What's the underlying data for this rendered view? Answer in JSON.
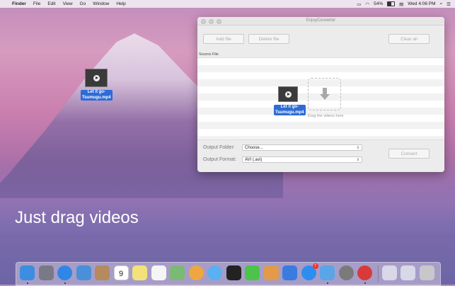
{
  "menubar": {
    "app_name": "Finder",
    "items": [
      "File",
      "Edit",
      "View",
      "Go",
      "Window",
      "Help"
    ],
    "battery_percent": "54%",
    "clock": "Wed 4:06 PM"
  },
  "desktop_file": {
    "name_line1": "Let it go-",
    "name_line2": "Tsumugu.mp4"
  },
  "window": {
    "title": "EnjoyConverter",
    "buttons": {
      "add": "Add file",
      "delete": "Delete file",
      "clear": "Clear all",
      "convert": "Convert"
    },
    "source_label": "Source File",
    "dragged_file": {
      "name_line1": "Let it go-",
      "name_line2": "Tsumugu.mp4"
    },
    "drop_hint": "Drag the videos here",
    "output_folder_label": "Output  Folder:",
    "output_folder_value": "Choose...",
    "output_format_label": "Output Format:",
    "output_format_value": "AVI (.avi)"
  },
  "headline": "Just drag videos",
  "dock": {
    "calendar_day": "9",
    "app_store_badge": "7",
    "icons": [
      {
        "name": "finder-icon",
        "color": "#3d8de0"
      },
      {
        "name": "launchpad-icon",
        "color": "#7a7a86"
      },
      {
        "name": "safari-icon",
        "color": "#2f86e6"
      },
      {
        "name": "mail-icon",
        "color": "#4a90d9"
      },
      {
        "name": "contacts-icon",
        "color": "#b48a5e"
      },
      {
        "name": "calendar-icon",
        "color": "#ffffff"
      },
      {
        "name": "notes-icon",
        "color": "#f3e27a"
      },
      {
        "name": "reminders-icon",
        "color": "#f5f5f5"
      },
      {
        "name": "maps-icon",
        "color": "#7cb974"
      },
      {
        "name": "photos-icon",
        "color": "#f0a640"
      },
      {
        "name": "messages-icon",
        "color": "#5ab0f0"
      },
      {
        "name": "qq-icon",
        "color": "#222222"
      },
      {
        "name": "facetime-icon",
        "color": "#4cc34a"
      },
      {
        "name": "pages-icon",
        "color": "#e39a4a"
      },
      {
        "name": "keynote-icon",
        "color": "#3a7be0"
      },
      {
        "name": "app-store-icon",
        "color": "#2c8ef0"
      },
      {
        "name": "xcode-icon",
        "color": "#5aa5e8"
      },
      {
        "name": "system-preferences-icon",
        "color": "#7a7a7a"
      },
      {
        "name": "enjoyconverter-icon",
        "color": "#d83a3a"
      },
      {
        "name": "desktop-folder-icon",
        "color": "#d8d8e8"
      },
      {
        "name": "downloads-folder-icon",
        "color": "#d8d8e8"
      },
      {
        "name": "trash-icon",
        "color": "#c8c8cc"
      }
    ]
  }
}
